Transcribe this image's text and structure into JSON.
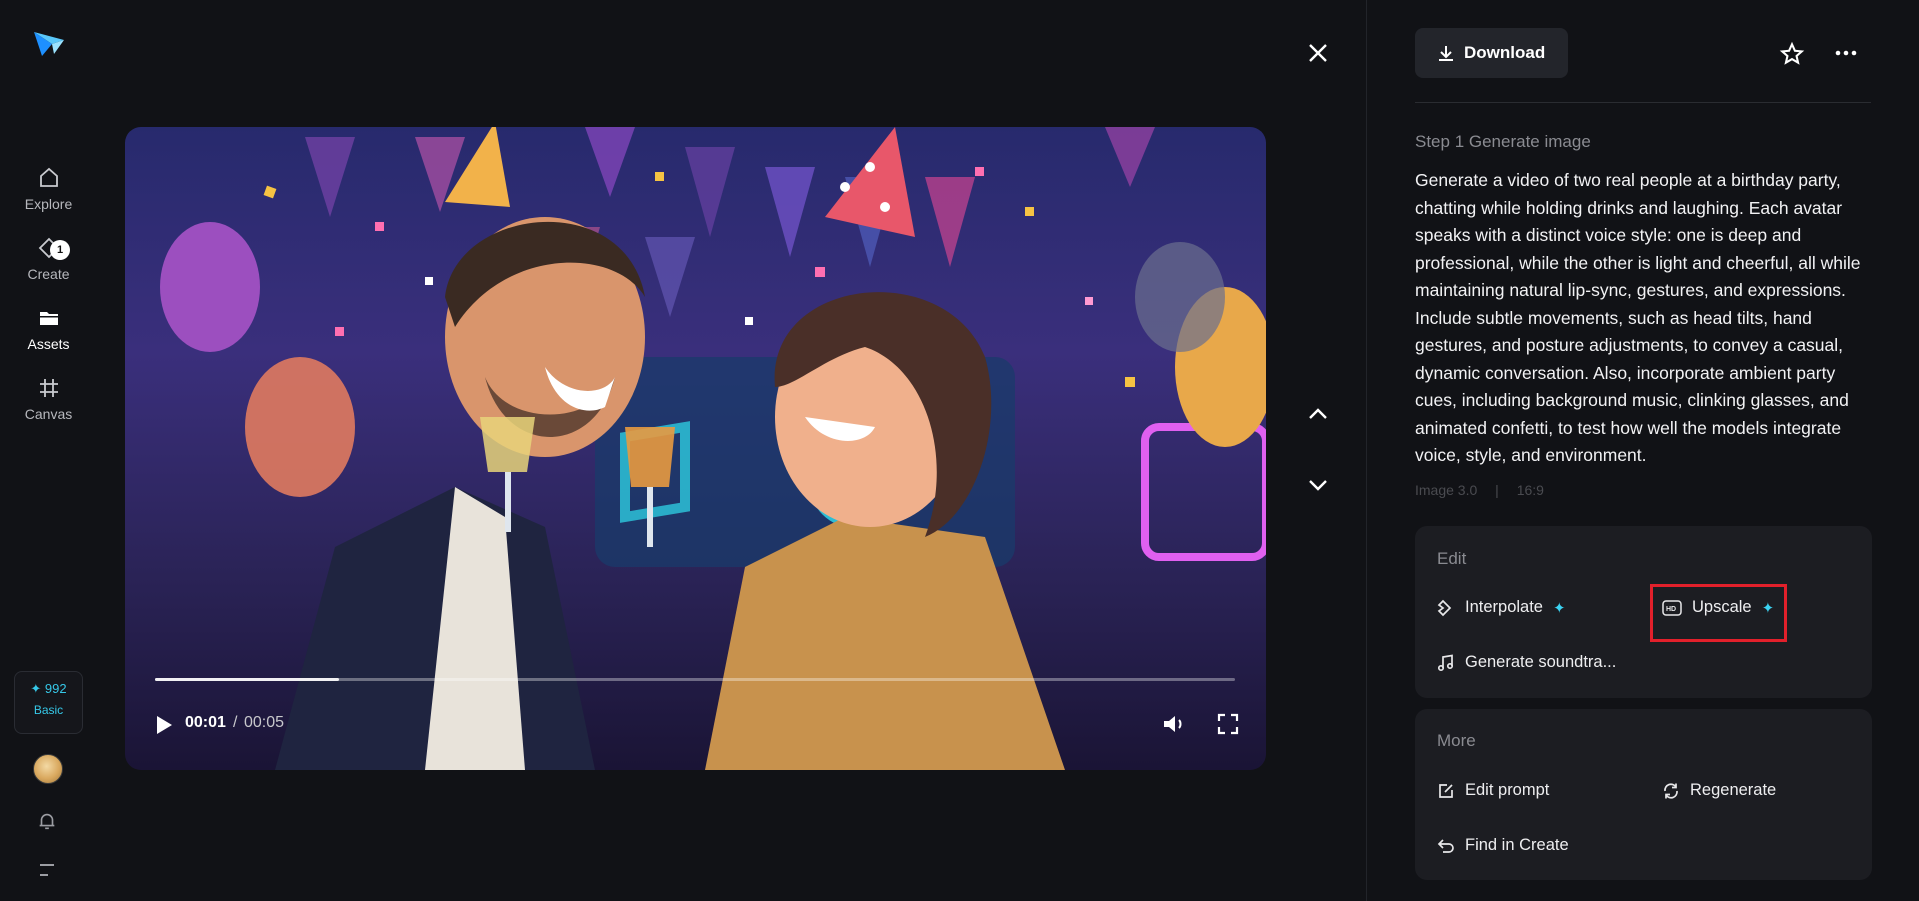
{
  "sidebar": {
    "items": [
      {
        "label": "Explore",
        "icon": "home-icon"
      },
      {
        "label": "Create",
        "icon": "create-sparkle-icon",
        "badge": "1"
      },
      {
        "label": "Assets",
        "icon": "folder-icon"
      },
      {
        "label": "Canvas",
        "icon": "canvas-frame-icon"
      }
    ],
    "credits": {
      "amount": "✦ 992",
      "plan": "Basic"
    }
  },
  "player": {
    "current_time": "00:01",
    "separator": "/",
    "total_time": "00:05",
    "progress": 0.17
  },
  "panel": {
    "download_label": "Download",
    "step_title": "Step 1 Generate image",
    "prompt": "Generate a video of two real people at a birthday party, chatting while holding drinks and laughing. Each avatar speaks with a distinct voice style: one is deep and professional, while the other is light and cheerful, all while maintaining natural lip-sync, gestures, and expressions. Include subtle movements, such as head tilts, hand gestures, and posture adjustments, to convey a casual, dynamic conversation. Also, incorporate ambient party cues, including background music, clinking glasses, and animated confetti, to test how well the models integrate voice, style, and environment.",
    "meta": [
      "Image 3.0",
      "|",
      "16:9"
    ],
    "edit": {
      "title": "Edit",
      "interpolate": "Interpolate",
      "upscale": "Upscale",
      "soundtrack": "Generate soundtra..."
    },
    "more": {
      "title": "More",
      "edit_prompt": "Edit prompt",
      "regenerate": "Regenerate",
      "find_in_create": "Find in Create"
    }
  },
  "colors": {
    "accent": "#36c8e8",
    "highlight_box": "#e2202b",
    "background": "#111216",
    "card": "#1c1d22"
  }
}
